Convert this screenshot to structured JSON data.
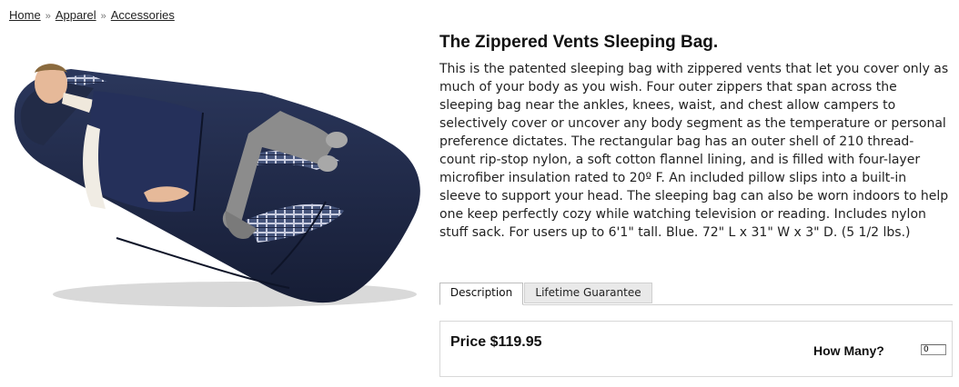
{
  "breadcrumb": {
    "items": [
      "Home",
      "Apparel",
      "Accessories"
    ],
    "separator": "»"
  },
  "product": {
    "title": "The Zippered Vents Sleeping Bag.",
    "description": "This is the patented sleeping bag with zippered vents that let you cover only as much of your body as you wish. Four outer zippers that span across the sleeping bag near the ankles, knees, waist, and chest allow campers to selectively cover or uncover any body segment as the temperature or personal preference dictates. The rectangular bag has an outer shell of 210 thread-count rip-stop nylon, a soft cotton flannel lining, and is filled with four-layer microfiber insulation rated to 20º F. An included pillow slips into a built-in sleeve to support your head. The sleeping bag can also be worn indoors to help one keep perfectly cozy while watching television or reading. Includes nylon stuff sack. For users up to 6'1\" tall. Blue. 72\" L x 31\" W x 3\" D. (5 1/2 lbs.)",
    "image_icon": "sleeping-bag-product-photo",
    "colors": {
      "bag": "#1f2a4a",
      "flannel": "#5b6a8f",
      "pants": "#8c8c8c"
    }
  },
  "tabs": [
    {
      "label": "Description",
      "active": true
    },
    {
      "label": "Lifetime Guarantee",
      "active": false
    }
  ],
  "purchase": {
    "price_label": "Price $119.95",
    "qty_label": "How Many?",
    "qty_value": "0"
  }
}
